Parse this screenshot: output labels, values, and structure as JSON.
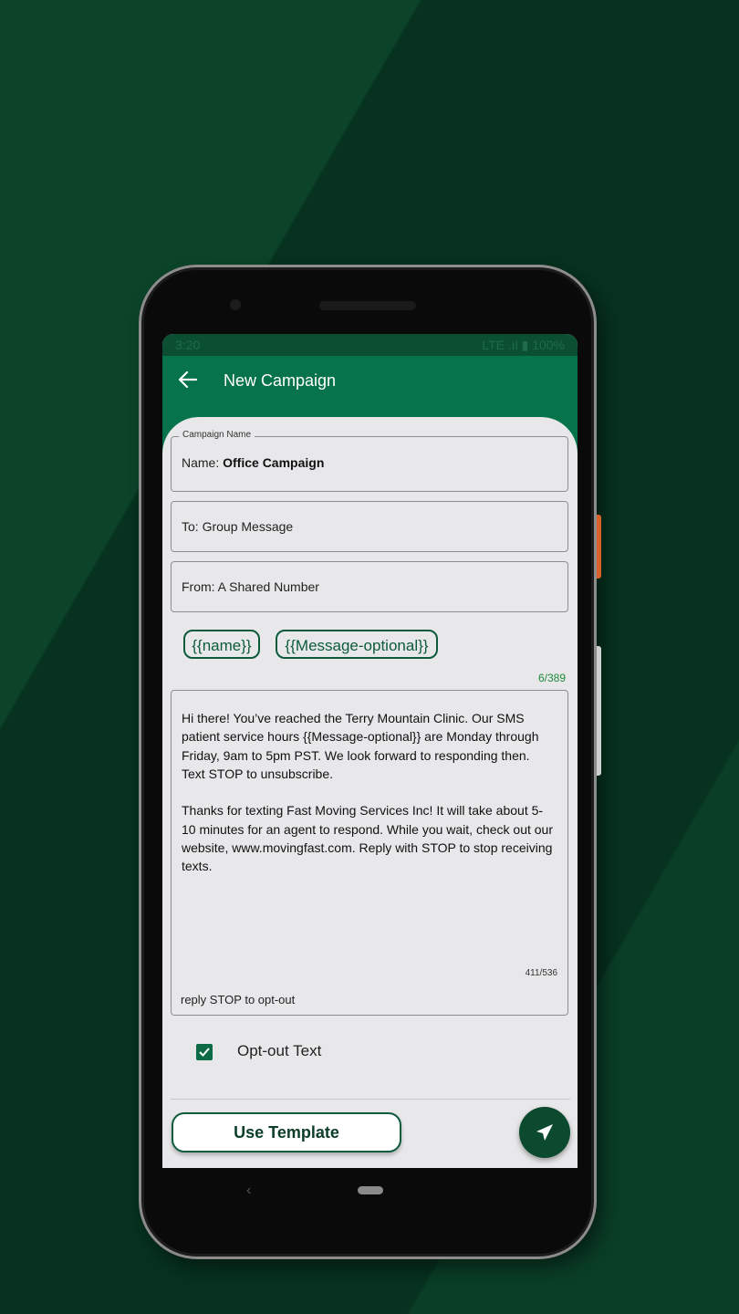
{
  "status_bar": {
    "time": "3:20",
    "network": "LTE",
    "battery": "100%"
  },
  "header": {
    "title": "New Campaign"
  },
  "campaign_name": {
    "legend": "Campaign Name",
    "prefix": "Name:",
    "value": "Office Campaign"
  },
  "to_field": {
    "text": "To: Group Message"
  },
  "from_field": {
    "text": "From: A Shared Number"
  },
  "chips": [
    "{{name}}",
    "{{Message-optional}}"
  ],
  "counter_top": "6/389",
  "message": {
    "text": "Hi there! You’ve reached the Terry Mountain Clinic. Our SMS patient service hours  {{Message-optional}} are Monday through Friday, 9am to 5pm PST. We look forward to responding then. Text STOP to unsubscribe.\n\nThanks for texting Fast Moving Services Inc! It will take about 5-10 minutes for an agent to respond. While you wait, check out our website, www.movingfast.com. Reply with STOP to stop receiving texts.",
    "count": "411/536",
    "optout_line": "reply STOP to opt-out"
  },
  "optout_checkbox": {
    "label": "Opt-out Text",
    "checked": true
  },
  "buttons": {
    "use_template": "Use Template"
  },
  "colors": {
    "primary": "#06734a",
    "dark": "#0b4a2e",
    "accent_text": "#1d8a3a"
  }
}
